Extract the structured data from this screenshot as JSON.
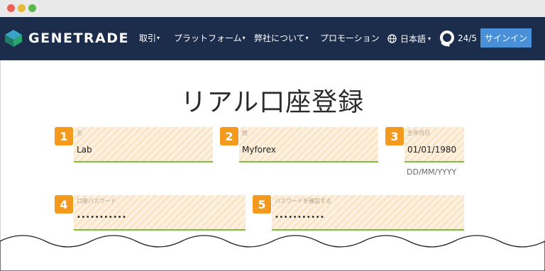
{
  "nav": {
    "brand": "GENETRADE",
    "items": [
      {
        "label": "取引"
      },
      {
        "label": "プラットフォーム"
      },
      {
        "label": "弊社について"
      },
      {
        "label": "プロモーション"
      }
    ],
    "language": "日本語",
    "support": "24/5",
    "signin": "サインイン"
  },
  "page": {
    "title": "リアル口座登録"
  },
  "form": {
    "fields": [
      {
        "num": "1",
        "label": "名",
        "value": "Lab"
      },
      {
        "num": "2",
        "label": "姓",
        "value": "Myforex"
      },
      {
        "num": "3",
        "label": "生年月日",
        "value": "01/01/1980",
        "hint": "DD/MM/YYYY"
      },
      {
        "num": "4",
        "label": "口座パスワード",
        "value": "•••••••••••"
      },
      {
        "num": "5",
        "label": "パスワードを確認する",
        "value": "•••••••••••"
      }
    ]
  },
  "colors": {
    "navbar": "#1c2d4c",
    "accent": "#4a90d9",
    "badge": "#f39a1e",
    "field_fill": "#fbe6c9",
    "field_underline": "#7bbf3a"
  }
}
